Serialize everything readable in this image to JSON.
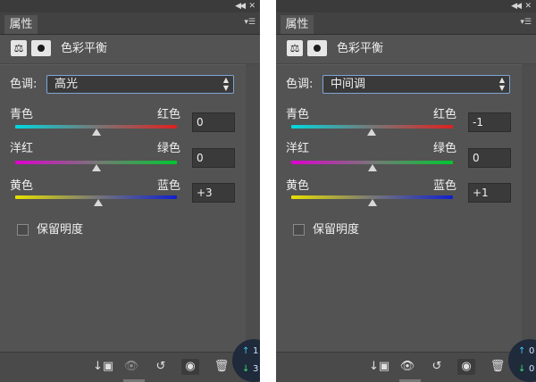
{
  "colors": {
    "panel_bg": "#535353",
    "accent_border": "#7fa5d6",
    "cyan_red_gradient": [
      "#00d8e0",
      "#777777",
      "#e02020"
    ],
    "magenta_green_gradient": [
      "#e000d0",
      "#777777",
      "#00c830"
    ],
    "yellow_blue_gradient": [
      "#e8e000",
      "#777777",
      "#1020d0"
    ]
  },
  "panels": [
    {
      "tab_label": "属性",
      "icons": {
        "collapse": "double-chevron-left-icon",
        "close": "close-icon",
        "menu": "panel-menu-icon",
        "adjustment": "balance-icon",
        "mask": "layer-mask-icon"
      },
      "title": "色彩平衡",
      "tone_label": "色调:",
      "tone_value": "高光",
      "sliders": [
        {
          "left_label": "青色",
          "right_label": "红色",
          "value": "0",
          "position": 0
        },
        {
          "left_label": "洋红",
          "right_label": "绿色",
          "value": "0",
          "position": 0
        },
        {
          "left_label": "黄色",
          "right_label": "蓝色",
          "value": "+3",
          "position": 3
        }
      ],
      "checkbox_label": "保留明度",
      "checkbox_checked": false,
      "footer_icons": [
        "clip-to-layer-icon",
        "view-previous-state-icon",
        "reset-icon",
        "visibility-eye-icon",
        "trash-icon"
      ],
      "badge_values": [
        "1",
        "3"
      ]
    },
    {
      "tab_label": "属性",
      "icons": {
        "collapse": "double-chevron-left-icon",
        "close": "close-icon",
        "menu": "panel-menu-icon",
        "adjustment": "balance-icon",
        "mask": "layer-mask-icon"
      },
      "title": "色彩平衡",
      "tone_label": "色调:",
      "tone_value": "中间调",
      "sliders": [
        {
          "left_label": "青色",
          "right_label": "红色",
          "value": "-1",
          "position": -1
        },
        {
          "left_label": "洋红",
          "right_label": "绿色",
          "value": "0",
          "position": 0
        },
        {
          "left_label": "黄色",
          "right_label": "蓝色",
          "value": "+1",
          "position": 1
        }
      ],
      "checkbox_label": "保留明度",
      "checkbox_checked": false,
      "footer_icons": [
        "clip-to-layer-icon",
        "view-previous-state-icon",
        "reset-icon",
        "visibility-eye-icon",
        "trash-icon"
      ],
      "badge_values": [
        "0",
        "0"
      ]
    }
  ]
}
